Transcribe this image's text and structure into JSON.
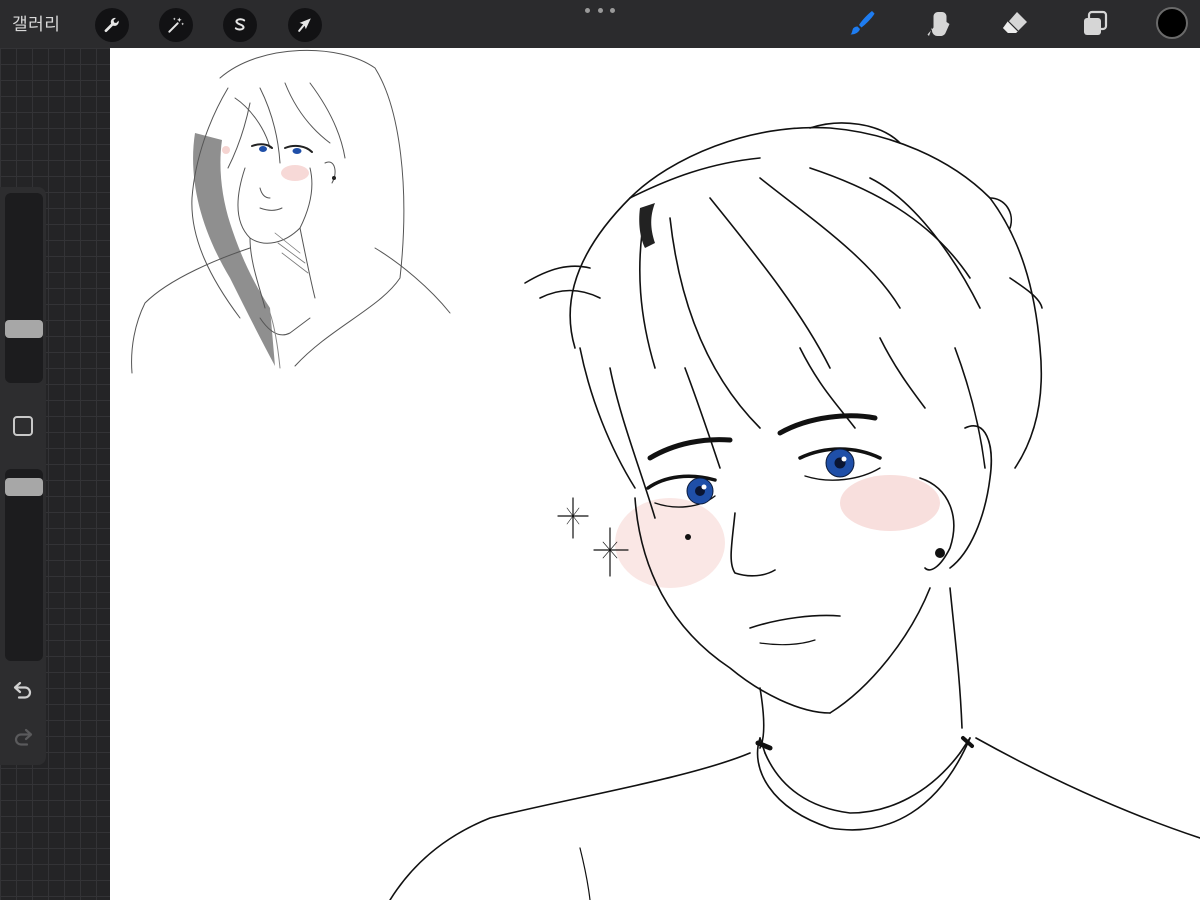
{
  "topbar": {
    "gallery_label": "갤러리",
    "left_tools": [
      {
        "name": "actions",
        "icon": "wrench-icon"
      },
      {
        "name": "adjustments",
        "icon": "magic-wand-icon"
      },
      {
        "name": "selection",
        "icon": "selection-s-icon"
      },
      {
        "name": "transform",
        "icon": "arrow-cursor-icon"
      }
    ],
    "more_icon": "more-dots-icon",
    "right_tools": [
      {
        "name": "brush",
        "icon": "brush-icon",
        "active": true
      },
      {
        "name": "smudge",
        "icon": "smudge-finger-icon",
        "active": false
      },
      {
        "name": "eraser",
        "icon": "eraser-icon",
        "active": false
      },
      {
        "name": "layers",
        "icon": "layers-icon",
        "active": false
      }
    ],
    "current_color": "#000000",
    "active_color": "#1e7cf0"
  },
  "sidebar": {
    "brush_size_level": 0.26,
    "opacity_level": 0.95,
    "modify_icon": "square-modify-icon",
    "undo_icon": "undo-icon",
    "redo_icon": "redo-icon"
  },
  "canvas": {
    "background": "#ffffff",
    "eye_color": "#1f4fa8",
    "blush_color": "#f3c9c6",
    "sketch_shadow": "#8f8f8f"
  }
}
